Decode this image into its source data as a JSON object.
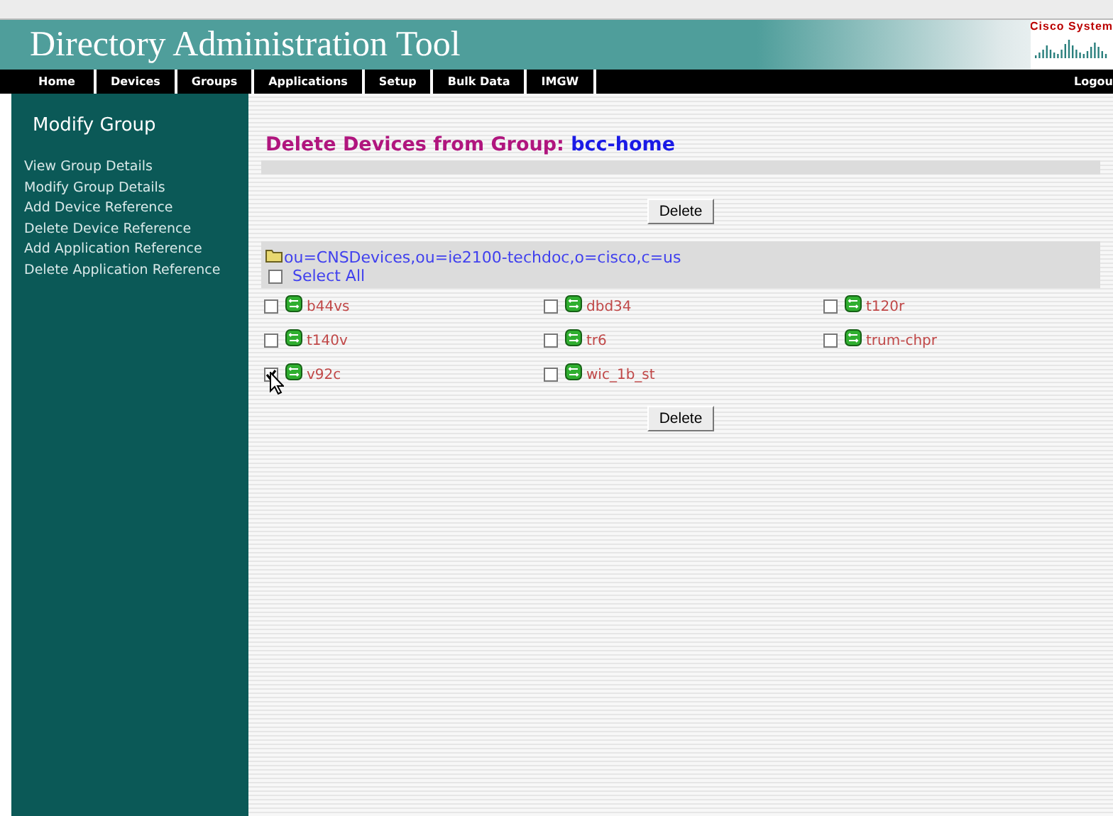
{
  "header": {
    "title": "Directory Administration Tool",
    "logo_text": "Cisco System"
  },
  "nav": {
    "items": [
      {
        "label": "Home"
      },
      {
        "label": "Devices"
      },
      {
        "label": "Groups"
      },
      {
        "label": "Applications"
      },
      {
        "label": "Setup"
      },
      {
        "label": "Bulk Data"
      },
      {
        "label": "IMGW"
      }
    ],
    "logout": "Logou"
  },
  "sidebar": {
    "title": "Modify Group",
    "items": [
      {
        "label": "View Group Details"
      },
      {
        "label": "Modify Group Details"
      },
      {
        "label": "Add Device Reference"
      },
      {
        "label": "Delete Device Reference"
      },
      {
        "label": "Add Application Reference"
      },
      {
        "label": "Delete Application Reference"
      }
    ]
  },
  "main": {
    "heading": "Delete Devices from Group:",
    "group": "bcc-home",
    "delete_buttons": [
      "Delete",
      "Delete"
    ],
    "container": "ou=CNSDevices,ou=ie2100-techdoc,o=cisco,c=us",
    "select_all": {
      "label": "Select All",
      "checked": false
    },
    "devices": [
      {
        "name": "b44vs",
        "checked": false
      },
      {
        "name": "dbd34",
        "checked": false
      },
      {
        "name": "t120r",
        "checked": false
      },
      {
        "name": "t140v",
        "checked": false
      },
      {
        "name": "tr6",
        "checked": false
      },
      {
        "name": "trum-chpr",
        "checked": false
      },
      {
        "name": "v92c",
        "checked": true
      },
      {
        "name": "wic_1b_st",
        "checked": false
      }
    ]
  }
}
